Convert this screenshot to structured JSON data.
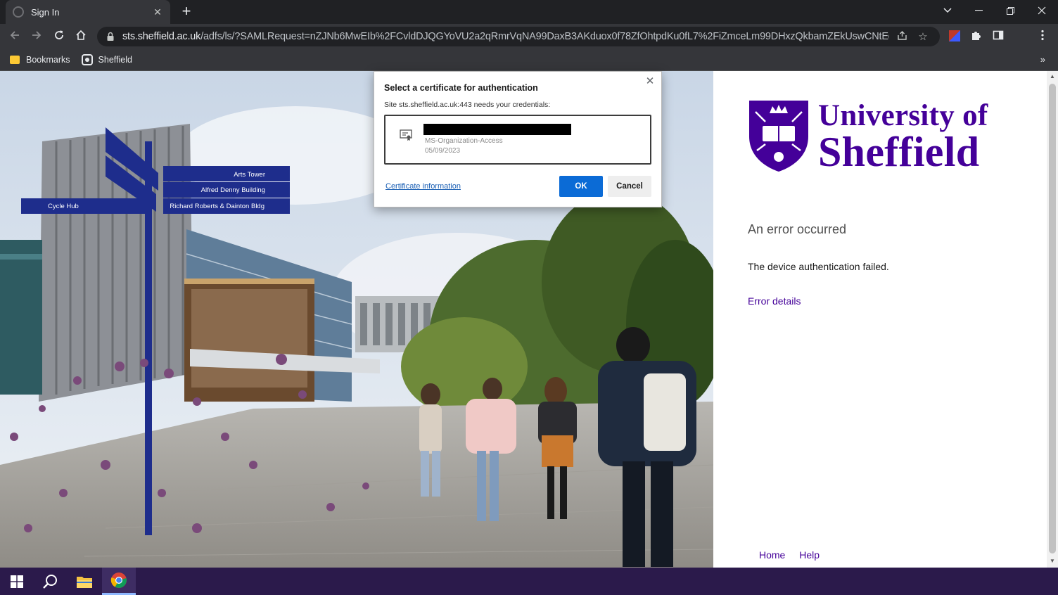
{
  "browser": {
    "tab_title": "Sign In",
    "url_host": "sts.sheffield.ac.uk",
    "url_rest": "/adfs/ls/?SAMLRequest=nZJNb6MwEIb%2FCvldDJQGYoVU2a2qRmrVqNA99DaxB3AKduox0f78ZfOhtpdKu0fL7%2FiZmceLm99DHxzQkbamZEkUswCNtEqbtmQv9V...",
    "bookmarks": [
      "Bookmarks",
      "Sheffield"
    ]
  },
  "dialog": {
    "title": "Select a certificate for authentication",
    "subtitle": "Site sts.sheffield.ac.uk:443 needs your credentials:",
    "cert_issuer": "MS-Organization-Access",
    "cert_date": "05/09/2023",
    "cert_info_link": "Certificate information",
    "ok_label": "OK",
    "cancel_label": "Cancel"
  },
  "photo": {
    "signs": [
      "Arts Tower",
      "Alfred Denny Building",
      "Richard Roberts & Dainton Bldg",
      "Cycle Hub"
    ]
  },
  "logo": {
    "line1": "University of",
    "line2": "Sheffield",
    "color": "#440099"
  },
  "error": {
    "title": "An error occurred",
    "message": "The device authentication failed.",
    "details_link": "Error details"
  },
  "footer": {
    "home": "Home",
    "help": "Help"
  },
  "colors": {
    "brand": "#440099",
    "ok_button": "#0b6bd6",
    "taskbar": "#2b1a4b"
  }
}
